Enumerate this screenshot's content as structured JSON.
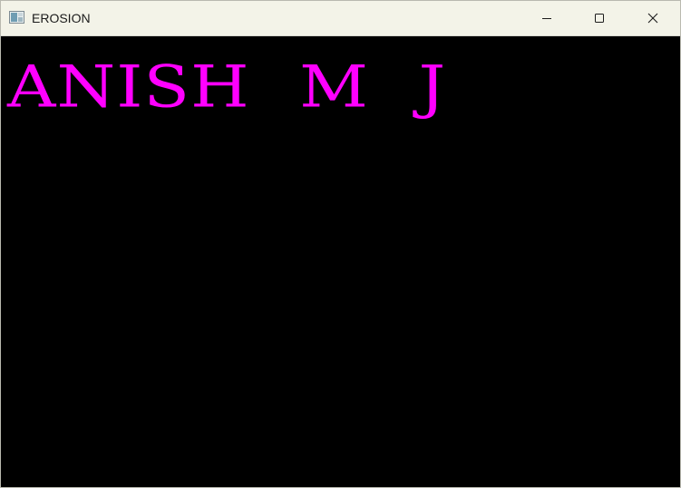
{
  "window": {
    "title": "EROSION",
    "app_icon": "image-window-icon"
  },
  "controls": {
    "minimize_icon": "minimize-icon",
    "maximize_icon": "maximize-icon",
    "close_icon": "close-icon"
  },
  "image": {
    "text": "ANISH M J",
    "text_color": "#ff00ff",
    "background_color": "#000000"
  }
}
